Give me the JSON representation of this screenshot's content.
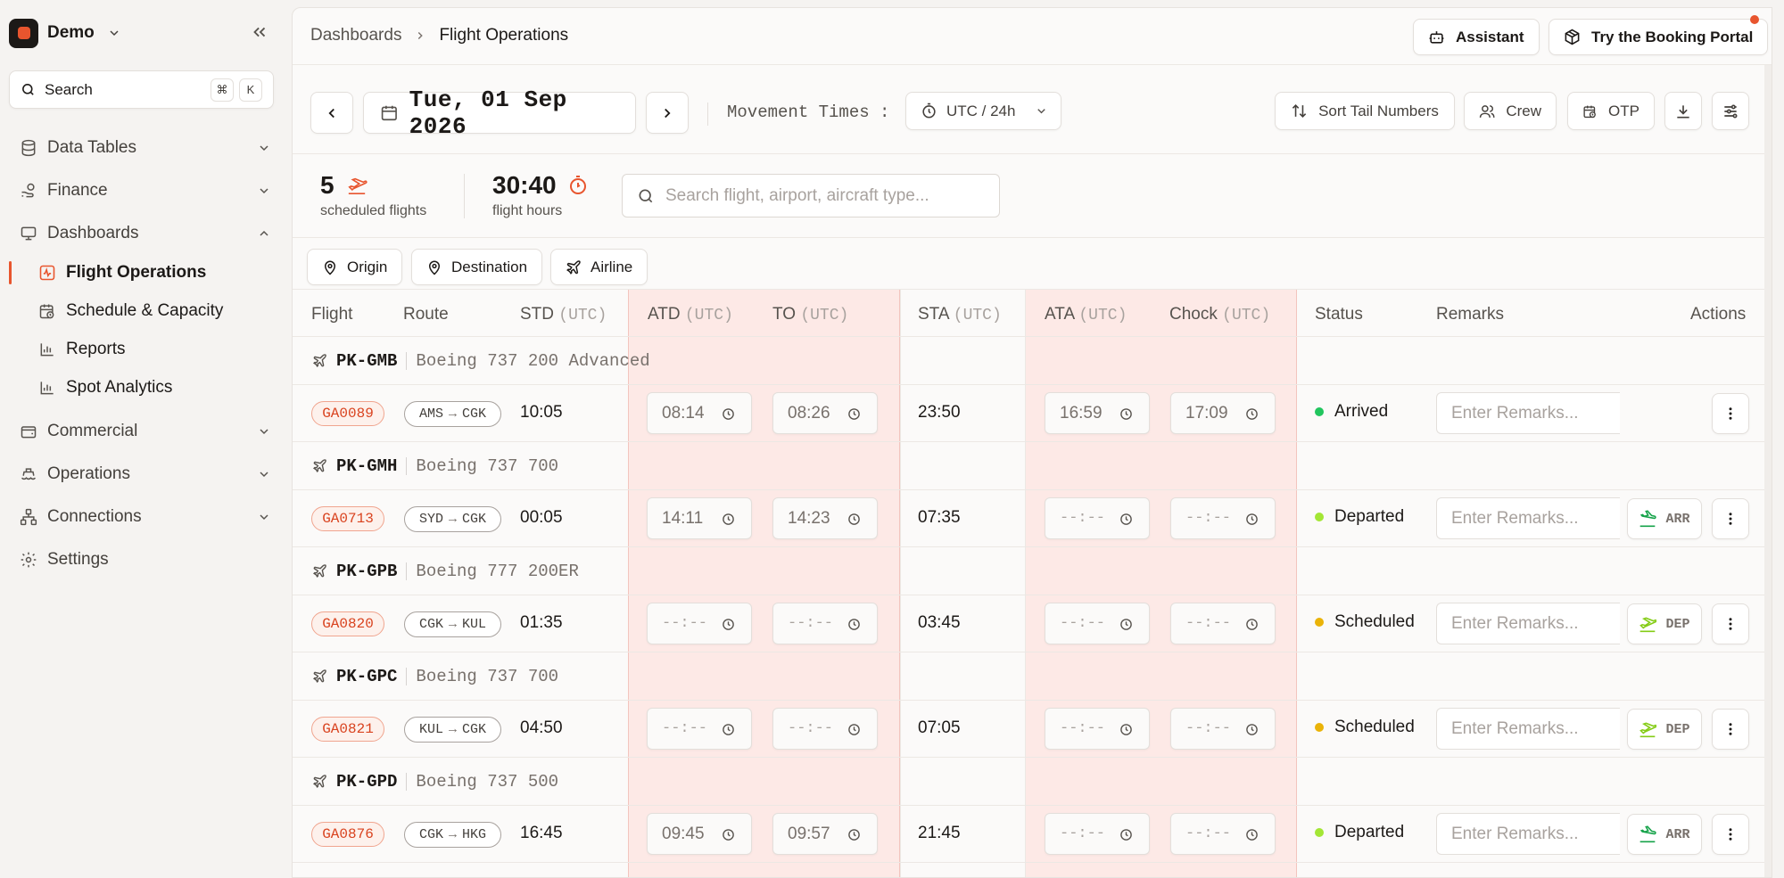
{
  "workspace": {
    "name": "Demo"
  },
  "sidebar": {
    "search_label": "Search",
    "shortcut": [
      "⌘",
      "K"
    ],
    "items": [
      {
        "label": "Data Tables",
        "icon": "database-icon"
      },
      {
        "label": "Finance",
        "icon": "hand-coins-icon"
      },
      {
        "label": "Dashboards",
        "icon": "monitor-icon"
      },
      {
        "label": "Commercial",
        "icon": "wallet-icon"
      },
      {
        "label": "Operations",
        "icon": "ship-icon"
      },
      {
        "label": "Connections",
        "icon": "network-icon"
      },
      {
        "label": "Settings",
        "icon": "gear-icon"
      }
    ],
    "sub_items": [
      {
        "label": "Flight Operations",
        "icon": "activity-icon"
      },
      {
        "label": "Schedule & Capacity",
        "icon": "calendar-clock-icon"
      },
      {
        "label": "Reports",
        "icon": "bar-chart-icon"
      },
      {
        "label": "Spot Analytics",
        "icon": "bar-chart-icon"
      }
    ]
  },
  "breadcrumb": {
    "parent": "Dashboards",
    "current": "Flight Operations"
  },
  "header": {
    "assistant_label": "Assistant",
    "portal_label": "Try the Booking Portal"
  },
  "toolbar": {
    "date": "Tue, 01 Sep 2026",
    "movement_label": "Movement Times :",
    "timezone": "UTC / 24h",
    "sort_label": "Sort Tail Numbers",
    "crew_label": "Crew",
    "otp_label": "OTP"
  },
  "stats": {
    "flights_count": "5",
    "flights_label": "scheduled flights",
    "hours": "30:40",
    "hours_label": "flight hours",
    "search_placeholder": "Search flight, airport, aircraft type..."
  },
  "filters": {
    "origin": "Origin",
    "destination": "Destination",
    "airline": "Airline"
  },
  "table": {
    "unit": "(UTC)",
    "headers": {
      "flight": "Flight",
      "route": "Route",
      "std": "STD",
      "atd": "ATD",
      "to": "TO",
      "sta": "STA",
      "ata": "ATA",
      "chock": "Chock",
      "status": "Status",
      "remarks": "Remarks",
      "actions": "Actions"
    },
    "remarks_placeholder": "Enter Remarks...",
    "rows": [
      {
        "tail": "PK-GMB",
        "type": "Boeing 737 200 Advanced",
        "flight": "GA0089",
        "from": "AMS",
        "to": "CGK",
        "std": "10:05",
        "atd": "08:14",
        "takeoff": "08:26",
        "sta": "23:50",
        "ata": "16:59",
        "chock": "17:09",
        "status": "Arrived",
        "status_color": "#22c55e",
        "action": ""
      },
      {
        "tail": "PK-GMH",
        "type": "Boeing 737 700",
        "flight": "GA0713",
        "from": "SYD",
        "to": "CGK",
        "std": "00:05",
        "atd": "14:11",
        "takeoff": "14:23",
        "sta": "07:35",
        "ata": "--:--",
        "chock": "--:--",
        "status": "Departed",
        "status_color": "#a3e635",
        "action": "ARR"
      },
      {
        "tail": "PK-GPB",
        "type": "Boeing 777 200ER",
        "flight": "GA0820",
        "from": "CGK",
        "to": "KUL",
        "std": "01:35",
        "atd": "--:--",
        "takeoff": "--:--",
        "sta": "03:45",
        "ata": "--:--",
        "chock": "--:--",
        "status": "Scheduled",
        "status_color": "#eab308",
        "action": "DEP"
      },
      {
        "tail": "PK-GPC",
        "type": "Boeing 737 700",
        "flight": "GA0821",
        "from": "KUL",
        "to": "CGK",
        "std": "04:50",
        "atd": "--:--",
        "takeoff": "--:--",
        "sta": "07:05",
        "ata": "--:--",
        "chock": "--:--",
        "status": "Scheduled",
        "status_color": "#eab308",
        "action": "DEP"
      },
      {
        "tail": "PK-GPD",
        "type": "Boeing 737 500",
        "flight": "GA0876",
        "from": "CGK",
        "to": "HKG",
        "std": "16:45",
        "atd": "09:45",
        "takeoff": "09:57",
        "sta": "21:45",
        "ata": "--:--",
        "chock": "--:--",
        "status": "Departed",
        "status_color": "#a3e635",
        "action": "ARR"
      }
    ]
  },
  "colors": {
    "accent": "#e8552e",
    "band": "#fde9e6"
  }
}
